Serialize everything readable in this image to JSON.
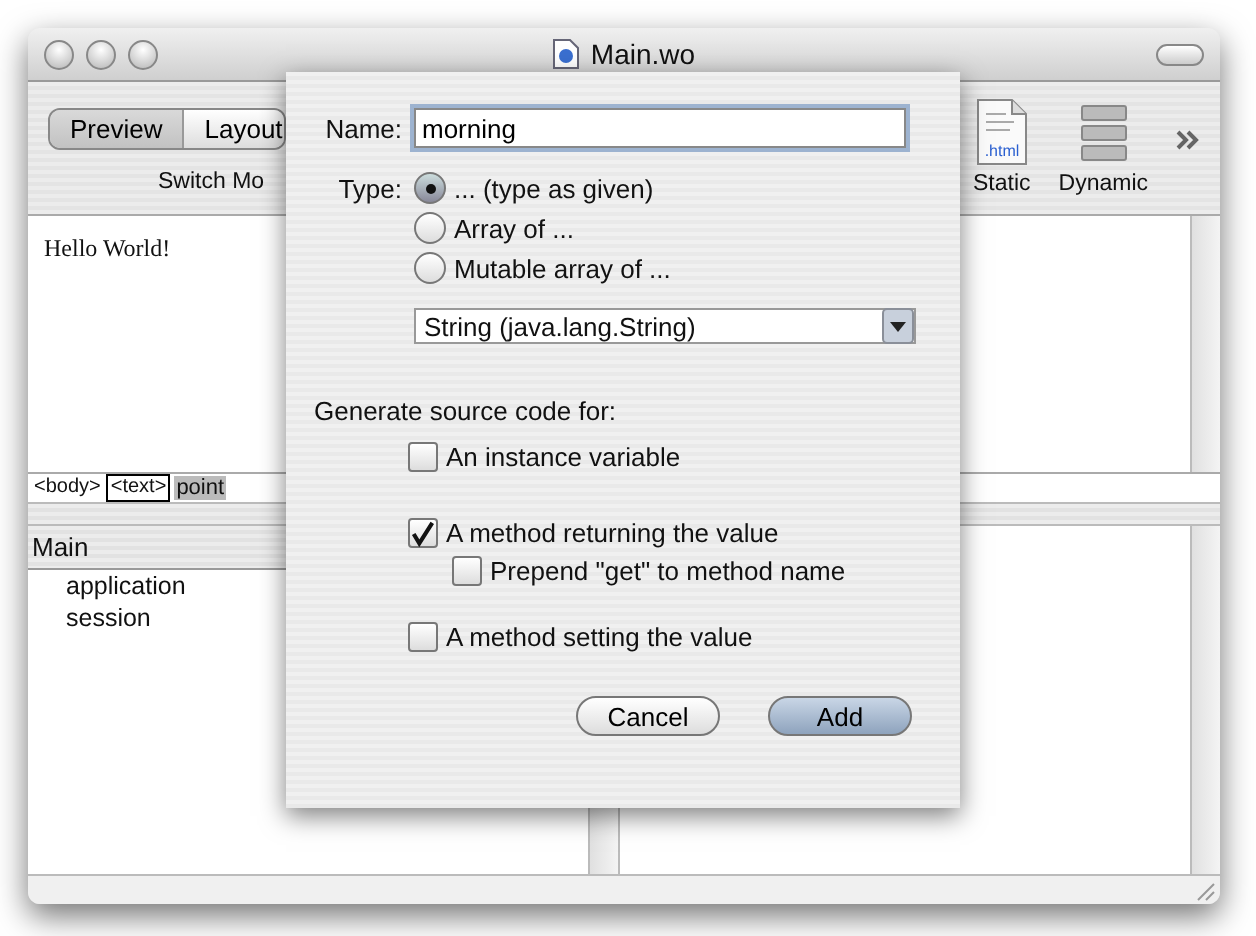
{
  "window": {
    "title": "Main.wo"
  },
  "toolbar": {
    "mode_buttons": [
      {
        "label": "Preview",
        "selected": true
      },
      {
        "label": "Layout",
        "selected": false
      }
    ],
    "mode_caption": "Switch Mo",
    "tools": [
      {
        "label": "Static",
        "kind": "html",
        "icon_text": ".html"
      },
      {
        "label": "Dynamic",
        "kind": "dynamic"
      }
    ]
  },
  "editor": {
    "text": "Hello World!"
  },
  "path_bar": [
    {
      "label": "<body>",
      "kind": "plain"
    },
    {
      "label": "<text>",
      "kind": "boxed"
    },
    {
      "label": "point",
      "kind": "highlight"
    }
  ],
  "browser": {
    "header": "Main",
    "items": [
      "application",
      "session"
    ]
  },
  "sheet": {
    "name_label": "Name:",
    "name_value": "morning",
    "type_label": "Type:",
    "type_options": [
      {
        "label": "... (type as given)",
        "selected": true
      },
      {
        "label": "Array of ...",
        "selected": false
      },
      {
        "label": "Mutable array of ...",
        "selected": false
      }
    ],
    "class_popup": "String (java.lang.String)",
    "generate_label": "Generate source code for:",
    "options": [
      {
        "label": "An instance variable",
        "checked": false
      },
      {
        "label": "A method returning the value",
        "checked": true,
        "children": [
          {
            "label": "Prepend \"get\" to method name",
            "checked": false
          }
        ]
      },
      {
        "label": "A method setting the value",
        "checked": false
      }
    ],
    "buttons": [
      {
        "label": "Cancel",
        "default": false
      },
      {
        "label": "Add",
        "default": true
      }
    ]
  }
}
